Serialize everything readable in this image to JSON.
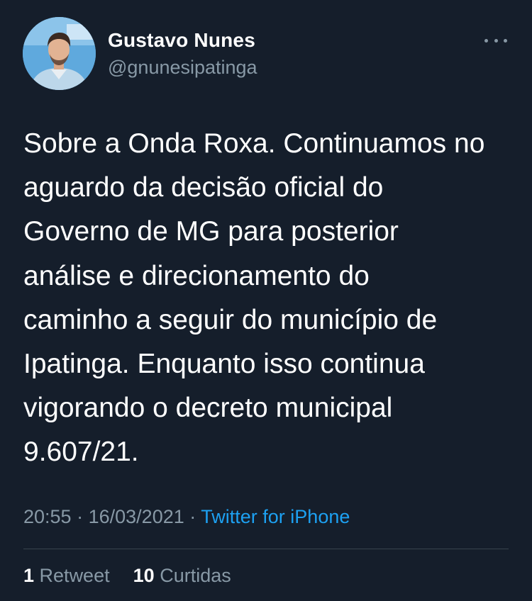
{
  "user": {
    "display_name": "Gustavo Nunes",
    "handle": "@gnunesipatinga"
  },
  "tweet": {
    "text": "Sobre a Onda Roxa. Continuamos no\naguardo da decisão oficial do\nGoverno de MG para posterior\nanálise e direcionamento do\ncaminho a seguir do município de\nIpatinga. Enquanto isso continua\nvigorando o decreto municipal\n9.607/21.",
    "time": "20:55",
    "separator": "·",
    "date": "16/03/2021",
    "source": "Twitter for iPhone"
  },
  "stats": {
    "retweets_count": "1",
    "retweets_label": "Retweet",
    "likes_count": "10",
    "likes_label": "Curtidas"
  },
  "icons": {
    "more": "more-horizontal-icon"
  },
  "colors": {
    "background": "#151e2b",
    "text": "#ffffff",
    "muted": "#8899a6",
    "link": "#1da1f2",
    "divider": "#38444d"
  }
}
